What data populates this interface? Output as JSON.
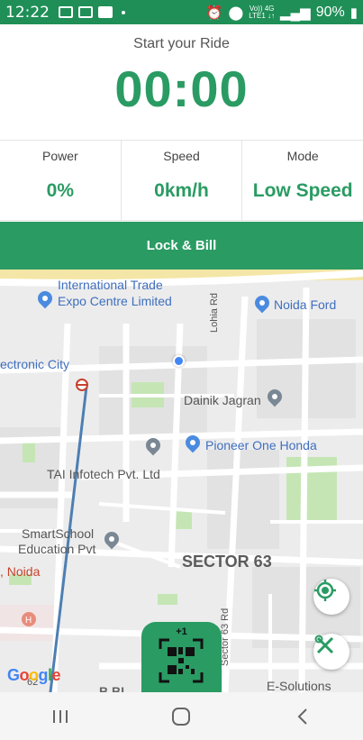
{
  "status_bar": {
    "time": "12:22",
    "network_small": "Vo)) 4G",
    "network_small2": "LTE1 ↓↑",
    "battery": "90%"
  },
  "ride": {
    "title": "Start your Ride",
    "timer": "00:00"
  },
  "stats": [
    {
      "label": "Power",
      "value": "0%"
    },
    {
      "label": "Speed",
      "value": "0km/h"
    },
    {
      "label": "Mode",
      "value": "Low Speed"
    }
  ],
  "actions": {
    "lock_bill": "Lock & Bill",
    "scan_badge": "+1"
  },
  "map": {
    "labels": {
      "expo1": "International Trade",
      "expo2": "Expo Centre Limited",
      "noida_ford": "Noida Ford",
      "electronic_city": "ectronic City",
      "lohia_rd": "Lohia Rd",
      "dainik": "Dainik Jagran",
      "pioneer": "Pioneer One Honda",
      "tai": "TAI Infotech Pvt. Ltd",
      "smartschool1": "SmartSchool",
      "smartschool2": "Education Pvt",
      "noida": ", Noida",
      "sector63": "SECTOR 63",
      "sector63rd": "Sector 63 Rd",
      "esolutions": "E-Solutions",
      "b_block": "B BL",
      "road62": "62",
      "google": "Google"
    },
    "colors": {
      "road": "#ffffff",
      "block": "#e4e4e4",
      "park": "#c5e6b4",
      "route": "#4d7fb3"
    }
  },
  "nav": {
    "recents": "recents-icon",
    "home": "home-icon",
    "back": "back-icon"
  }
}
